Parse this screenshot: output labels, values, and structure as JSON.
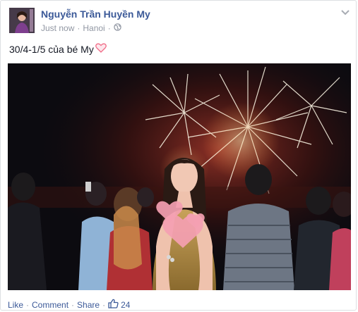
{
  "post": {
    "author_name": "Nguyễn Trần Huyền My",
    "timestamp": "Just now",
    "location": "Hanoi",
    "privacy_icon": "globe-icon",
    "text": "30/4-1/5 của bé My",
    "emoji": "heart-outline-icon"
  },
  "actions": {
    "like": "Like",
    "comment": "Comment",
    "share": "Share",
    "separator": "·",
    "like_count": "24"
  },
  "colors": {
    "link": "#3b5998",
    "meta": "#9197a3",
    "heart": "#f06b86"
  }
}
